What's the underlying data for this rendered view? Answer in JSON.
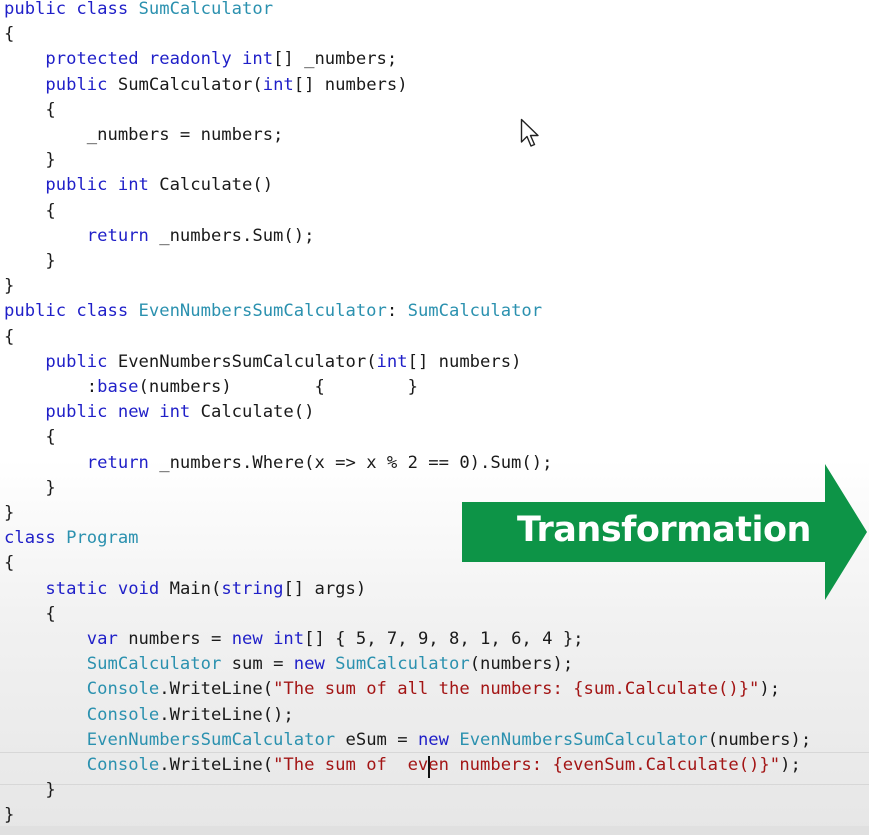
{
  "banner": {
    "label": "Transformation",
    "fill_color": "#0d9447"
  },
  "cursor_icon": "mouse-pointer-icon",
  "colors": {
    "keyword": "#1f1fc8",
    "type": "#2b91af",
    "string": "#a31515",
    "text": "#1a1a1a"
  },
  "code": {
    "lines": [
      [
        [
          "public class ",
          "kw"
        ],
        [
          "SumCalculator",
          "ty"
        ]
      ],
      [
        [
          "{",
          "tx"
        ]
      ],
      [
        [
          "    ",
          "tx"
        ],
        [
          "protected readonly int",
          "kw"
        ],
        [
          "[] _numbers;",
          "tx"
        ]
      ],
      [
        [
          "    ",
          "tx"
        ],
        [
          "public ",
          "kw"
        ],
        [
          "SumCalculator(",
          "tx"
        ],
        [
          "int",
          "kw"
        ],
        [
          "[] numbers)",
          "tx"
        ]
      ],
      [
        [
          "    {",
          "tx"
        ]
      ],
      [
        [
          "        _numbers = numbers;",
          "tx"
        ]
      ],
      [
        [
          "    }",
          "tx"
        ]
      ],
      [
        [
          "    ",
          "tx"
        ],
        [
          "public int ",
          "kw"
        ],
        [
          "Calculate()",
          "tx"
        ]
      ],
      [
        [
          "    {",
          "tx"
        ]
      ],
      [
        [
          "        ",
          "tx"
        ],
        [
          "return ",
          "kw"
        ],
        [
          "_numbers.Sum();",
          "tx"
        ]
      ],
      [
        [
          "    }",
          "tx"
        ]
      ],
      [
        [
          "}",
          "tx"
        ]
      ],
      [
        [
          "public class ",
          "kw"
        ],
        [
          "EvenNumbersSumCalculator",
          "ty"
        ],
        [
          ": ",
          "tx"
        ],
        [
          "SumCalculator",
          "ty"
        ]
      ],
      [
        [
          "{",
          "tx"
        ]
      ],
      [
        [
          "    ",
          "tx"
        ],
        [
          "public ",
          "kw"
        ],
        [
          "EvenNumbersSumCalculator(",
          "tx"
        ],
        [
          "int",
          "kw"
        ],
        [
          "[] numbers)",
          "tx"
        ]
      ],
      [
        [
          "        :",
          "tx"
        ],
        [
          "base",
          "kw"
        ],
        [
          "(numbers)        {        }",
          "tx"
        ]
      ],
      [
        [
          "    ",
          "tx"
        ],
        [
          "public new int ",
          "kw"
        ],
        [
          "Calculate()",
          "tx"
        ]
      ],
      [
        [
          "    {",
          "tx"
        ]
      ],
      [
        [
          "        ",
          "tx"
        ],
        [
          "return ",
          "kw"
        ],
        [
          "_numbers.Where(x => x % 2 == 0).Sum();",
          "tx"
        ]
      ],
      [
        [
          "    }",
          "tx"
        ]
      ],
      [
        [
          "}",
          "tx"
        ]
      ],
      [
        [
          "class ",
          "kw"
        ],
        [
          "Program",
          "ty"
        ]
      ],
      [
        [
          "{",
          "tx"
        ]
      ],
      [
        [
          "    ",
          "tx"
        ],
        [
          "static void ",
          "kw"
        ],
        [
          "Main(",
          "tx"
        ],
        [
          "string",
          "kw"
        ],
        [
          "[] args)",
          "tx"
        ]
      ],
      [
        [
          "    {",
          "tx"
        ]
      ],
      [
        [
          "        ",
          "tx"
        ],
        [
          "var ",
          "kw"
        ],
        [
          "numbers = ",
          "tx"
        ],
        [
          "new int",
          "kw"
        ],
        [
          "[] { 5, 7, 9, 8, 1, 6, 4 };",
          "tx"
        ]
      ],
      [
        [
          "        ",
          "tx"
        ],
        [
          "SumCalculator ",
          "ty"
        ],
        [
          "sum = ",
          "tx"
        ],
        [
          "new ",
          "kw"
        ],
        [
          "SumCalculator",
          "ty"
        ],
        [
          "(numbers);",
          "tx"
        ]
      ],
      [
        [
          "        ",
          "tx"
        ],
        [
          "Console",
          "ty"
        ],
        [
          ".WriteLine(",
          "tx"
        ],
        [
          "\"The sum of all the numbers: {sum.Calculate()}\"",
          "st"
        ],
        [
          ");",
          "tx"
        ]
      ],
      [
        [
          "        ",
          "tx"
        ],
        [
          "Console",
          "ty"
        ],
        [
          ".WriteLine();",
          "tx"
        ]
      ],
      [
        [
          "        ",
          "tx"
        ],
        [
          "EvenNumbersSumCalculator ",
          "ty"
        ],
        [
          "eSum = ",
          "tx"
        ],
        [
          "new ",
          "kw"
        ],
        [
          "EvenNumbersSumCalculator",
          "ty"
        ],
        [
          "(numbers);",
          "tx"
        ]
      ],
      [
        [
          "        ",
          "tx"
        ],
        [
          "Console",
          "ty"
        ],
        [
          ".WriteLine(",
          "tx"
        ],
        [
          "\"The sum of  even numbers: {evenSum.Calculate()}\"",
          "st"
        ],
        [
          ");",
          "tx"
        ]
      ],
      [
        [
          "    }",
          "tx"
        ]
      ],
      [
        [
          "}",
          "tx"
        ]
      ]
    ]
  }
}
